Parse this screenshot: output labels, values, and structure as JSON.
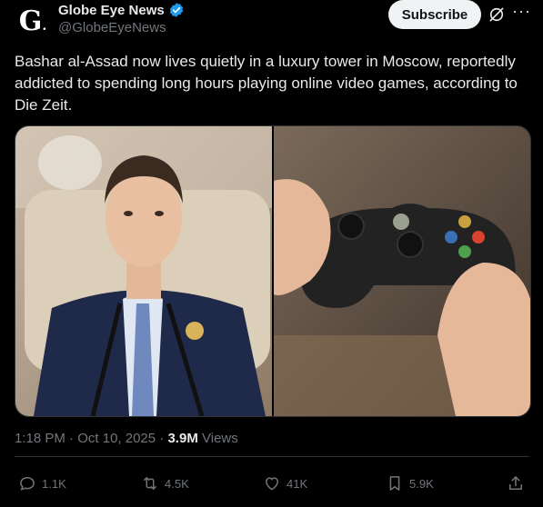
{
  "header": {
    "avatar_letter": "G",
    "display_name": "Globe Eye News",
    "handle": "@GlobeEyeNews",
    "subscribe_label": "Subscribe"
  },
  "tweet": {
    "text": "Bashar al-Assad now lives quietly in a luxury tower in Moscow, reportedly addicted to spending long hours playing online video games, according to Die Zeit."
  },
  "media": {
    "left_image": "photo of man in suit at microphones",
    "right_image": "photo of hands holding a game controller"
  },
  "meta": {
    "time": "1:18 PM",
    "date": "Oct 10, 2025",
    "separator": " · ",
    "views_count": "3.9M",
    "views_label": "Views"
  },
  "actions": {
    "replies": "1.1K",
    "reposts": "4.5K",
    "likes": "41K",
    "bookmarks": "5.9K"
  },
  "colors": {
    "background": "#000000",
    "text": "#e7e9ea",
    "muted": "#71767b",
    "verified": "#1d9bf0",
    "button_bg": "#eff3f4"
  }
}
